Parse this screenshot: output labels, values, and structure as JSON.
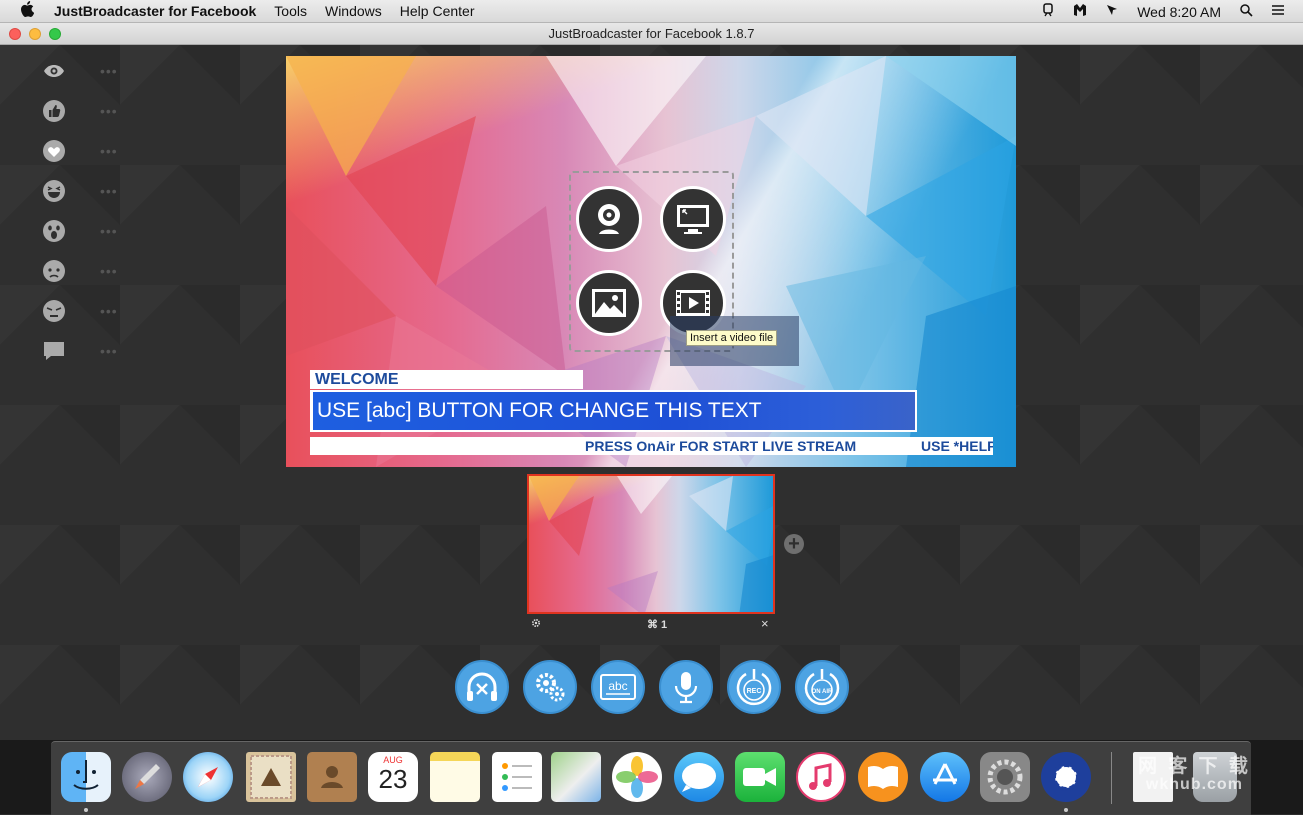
{
  "menubar": {
    "apple_icon": "apple-icon",
    "app_name": "JustBroadcaster for Facebook",
    "menus": [
      "Tools",
      "Windows",
      "Help Center"
    ],
    "clock": "Wed 8:20 AM",
    "status_icons": [
      "train-icon",
      "malwarebytes-icon",
      "screen-record-icon",
      "search-icon",
      "list-icon"
    ]
  },
  "window": {
    "title": "JustBroadcaster for Facebook 1.8.7"
  },
  "sidebar": {
    "reactions": [
      {
        "icon": "eye-icon",
        "count": "•••"
      },
      {
        "icon": "like-icon",
        "count": "•••"
      },
      {
        "icon": "heart-icon",
        "count": "•••"
      },
      {
        "icon": "haha-icon",
        "count": "•••"
      },
      {
        "icon": "wow-icon",
        "count": "•••"
      },
      {
        "icon": "sad-icon",
        "count": "•••"
      },
      {
        "icon": "angry-icon",
        "count": "•••"
      },
      {
        "icon": "comment-icon",
        "count": "•••"
      }
    ]
  },
  "preview": {
    "sources": [
      "webcam-icon",
      "screen-capture-icon",
      "image-icon",
      "video-file-icon"
    ],
    "tooltip": "Insert a video file",
    "lower_third": {
      "tag": "WELCOME",
      "headline": "USE [abc] BUTTON FOR CHANGE THIS TEXT",
      "ticker_1": "PRESS  OnAir  FOR START LIVE STREAM",
      "ticker_2": "USE *HELP"
    }
  },
  "scenes": {
    "selected_color": "#e0331f",
    "add_label": "+",
    "settings_icon": "gear-icon",
    "shortcut": "⌘ 1",
    "close_label": "×"
  },
  "toolbar": {
    "accent": "#4da3e3",
    "buttons": [
      {
        "name": "audio-mute",
        "icon": "headphones-mute-icon"
      },
      {
        "name": "settings",
        "icon": "gears-icon"
      },
      {
        "name": "text-edit",
        "icon": "abc-text-icon",
        "label": "abc"
      },
      {
        "name": "microphone",
        "icon": "microphone-icon"
      },
      {
        "name": "record",
        "icon": "rec-icon",
        "label": "REC"
      },
      {
        "name": "on-air",
        "icon": "on-air-icon",
        "label": "ON AIR"
      }
    ]
  },
  "dock": {
    "apps": [
      "finder-icon",
      "launchpad-icon",
      "safari-icon",
      "mail-icon",
      "contacts-icon",
      "calendar-icon",
      "notes-icon",
      "reminders-icon",
      "maps-icon",
      "photos-icon",
      "messages-icon",
      "facetime-icon",
      "itunes-icon",
      "ibooks-icon",
      "app-store-icon",
      "system-preferences-icon",
      "justbroadcaster-icon",
      "document-icon",
      "trash-icon"
    ],
    "calendar_month": "AUG",
    "calendar_day": "23",
    "watermark_line1": "网 客 下 载",
    "watermark_line2": "wkhub.com"
  }
}
